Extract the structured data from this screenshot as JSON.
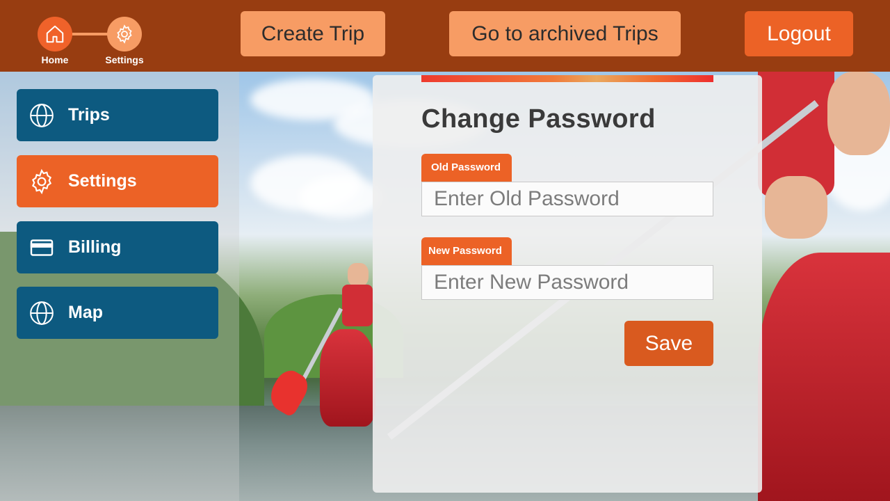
{
  "header": {
    "breadcrumb": [
      {
        "label": "Home",
        "icon": "home-icon"
      },
      {
        "label": "Settings",
        "icon": "gear-icon"
      }
    ],
    "buttons": {
      "create_trip": "Create Trip",
      "archived_trips": "Go to archived Trips",
      "logout": "Logout"
    }
  },
  "sidebar": {
    "items": [
      {
        "label": "Trips",
        "icon": "globe-icon",
        "active": false
      },
      {
        "label": "Settings",
        "icon": "gear-icon",
        "active": true
      },
      {
        "label": "Billing",
        "icon": "credit-card-icon",
        "active": false
      },
      {
        "label": "Map",
        "icon": "globe-icon",
        "active": false
      }
    ]
  },
  "form": {
    "title": "Change Password",
    "old_password": {
      "label": "Old Password",
      "placeholder": "Enter Old Password",
      "value": ""
    },
    "new_password": {
      "label": "New Password",
      "placeholder": "Enter New Password",
      "value": ""
    },
    "save_label": "Save"
  },
  "colors": {
    "header_bg": "#983d11",
    "accent_orange": "#ec6226",
    "light_orange": "#f79c64",
    "nav_blue": "#0d5a80"
  }
}
